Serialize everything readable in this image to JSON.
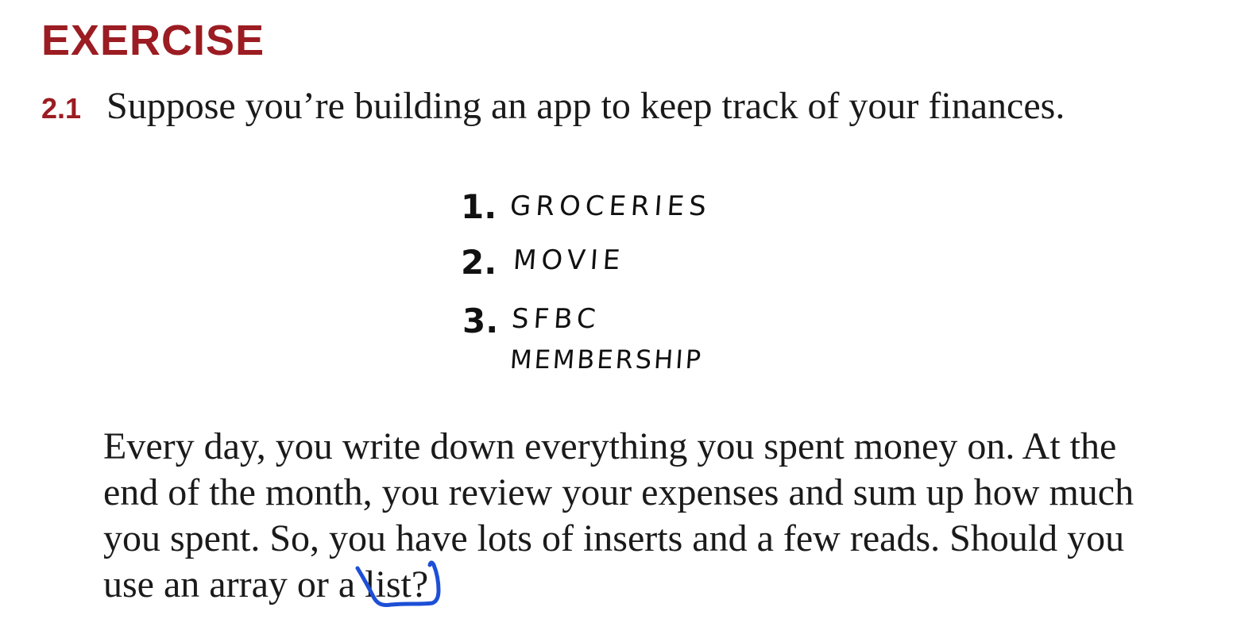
{
  "heading": "EXERCISE",
  "exercise": {
    "number": "2.1",
    "prompt": "Suppose you’re building an app to keep track of your finances."
  },
  "sketch_list": [
    {
      "num": "1.",
      "label": "GROCERIES"
    },
    {
      "num": "2.",
      "label": "MOVIE"
    },
    {
      "num": "3.",
      "label": "SFBC"
    },
    {
      "num": "",
      "label": "MEMBERSHIP"
    }
  ],
  "body": {
    "line1": "Every day, you write down everything you spent money on. At the",
    "line2": "end of the month, you review your expenses and sum up how much",
    "line3": "you spent. So, you have lots of inserts and a few reads. Should you",
    "line4": "use an array or a list?"
  },
  "colors": {
    "heading": "#9b1c22",
    "annotation": "#1d4fd6"
  }
}
